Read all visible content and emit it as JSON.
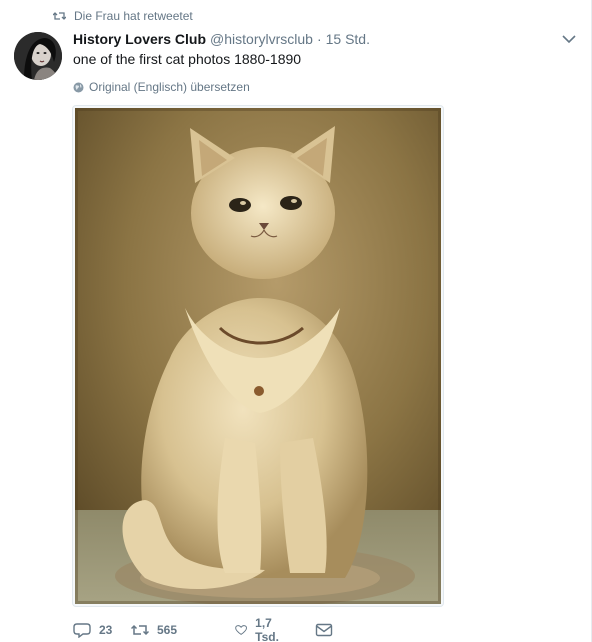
{
  "retweet_context": {
    "text": "Die Frau hat retweetet",
    "icon": "retweet-icon"
  },
  "tweet": {
    "display_name": "History Lovers Club",
    "username": "@historylvrsclub",
    "separator": "·",
    "time": "15 Std.",
    "text": "one of the first cat photos 1880-1890",
    "translate_label": "Original (Englisch) übersetzen",
    "caret_icon": "chevron-down-icon"
  },
  "media": {
    "subject": "sepia-cat-photo",
    "icon": "cat-photo"
  },
  "actions": {
    "reply": {
      "count": "23",
      "icon": "reply-icon"
    },
    "retweet": {
      "count": "565",
      "icon": "retweet-icon"
    },
    "like": {
      "count": "1,7 Tsd.",
      "icon": "heart-icon"
    },
    "dm": {
      "icon": "envelope-icon"
    }
  },
  "colors": {
    "text": "#14171a",
    "secondary": "#657786",
    "border": "#e1e8ed",
    "sepia_dark": "#5b4a2c",
    "sepia_light": "#c9b487"
  }
}
